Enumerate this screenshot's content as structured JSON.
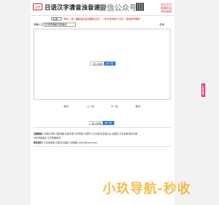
{
  "header": {
    "logo_text": "汉字",
    "site_title": "日语汉字清音浊音速查",
    "wechat": "微信公众号:",
    "links": [
      "设为主页",
      "收藏本站",
      "网站地图"
    ]
  },
  "search": {
    "select_value": "汉语",
    "hint": "提示：请一键批量在此处翻译汉字，一次可查询多个汉字，请用逗号隔开",
    "input_label": "请输入文字:",
    "input_value": "汉字拼音和日语读法",
    "button": "查询"
  },
  "result": {
    "btn1": "深入探索",
    "btn2": "全广告"
  },
  "pager": [
    "首页",
    "上一页",
    "下一页",
    "尾页"
  ],
  "mid_buttons": [
    "深入探索",
    "全广告"
  ],
  "footer": {
    "line1_label": "友情链接:",
    "line1": "中国汉字网 汉语词典 在线字典 汉字拼音 日语学习 汉字查询 成语大全 百家姓 汉字字典 新华字典",
    "line2": "汉字拼音读法 汉字笔顺查询",
    "line3_label": "联系我们:",
    "line3": "汉字速查网 日语汉字速查 QQ邮箱: admin@mail.com"
  },
  "side_tab": "在线客服",
  "watermark": "小玖导航-秒收"
}
